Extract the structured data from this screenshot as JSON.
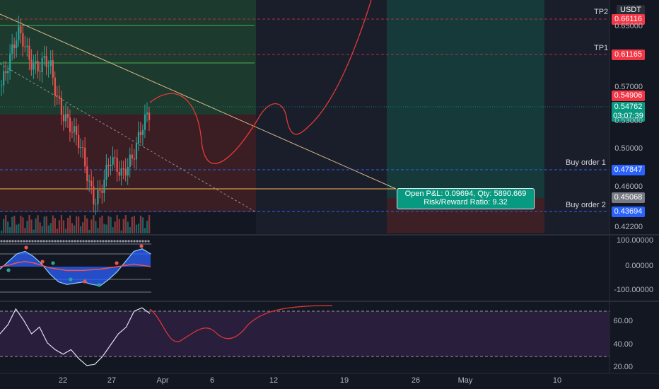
{
  "currency": "USDT",
  "levels": {
    "tp2": {
      "label": "TP2",
      "price": "0.66116"
    },
    "tp1": {
      "label": "TP1",
      "price": "0.61165"
    },
    "entry_upper": {
      "price": "0.54906"
    },
    "current": {
      "price": "0.54762",
      "countdown": "03:07:39"
    },
    "buy1": {
      "label": "Buy order 1",
      "price": "0.47847"
    },
    "mid": {
      "price": "0.45068"
    },
    "buy2": {
      "label": "Buy order 2",
      "price": "0.43694"
    }
  },
  "position_info": {
    "line1": "Open P&L: 0.09694, Qty: 5890.669",
    "line2": "Risk/Reward Ratio: 9.32"
  },
  "colors": {
    "background": "#131722",
    "up": "#26a69a",
    "down": "#ef5350",
    "projection": "#e53935",
    "tp_badge": "#f23645",
    "buy_badge": "#2962ff",
    "current_badge": "#089981"
  },
  "chart_data": [
    {
      "type": "line",
      "name": "price",
      "y_axis_ticks": [
        "0.65000",
        "0.57000",
        "0.53000",
        "0.50000",
        "0.46000",
        "0.42200"
      ],
      "x_axis_ticks": [
        "22",
        "27",
        "Apr",
        "6",
        "12",
        "19",
        "26",
        "May",
        "10"
      ],
      "ylim": [
        0.415,
        0.675
      ],
      "candles_approx_close": [
        0.58,
        0.6,
        0.62,
        0.64,
        0.63,
        0.61,
        0.6,
        0.6,
        0.61,
        0.6,
        0.57,
        0.55,
        0.54,
        0.53,
        0.52,
        0.5,
        0.47,
        0.45,
        0.46,
        0.48,
        0.5,
        0.49,
        0.48,
        0.49,
        0.5,
        0.52,
        0.54,
        0.548
      ]
    },
    {
      "type": "line",
      "name": "oscillator",
      "y_axis_ticks": [
        "100.00000",
        "0.00000",
        "-100.00000"
      ],
      "ylim": [
        -120,
        120
      ]
    },
    {
      "type": "line",
      "name": "rsi",
      "y_axis_ticks": [
        "60.00",
        "40.00",
        "20.00"
      ],
      "ylim": [
        15,
        85
      ],
      "values": [
        50,
        58,
        72,
        62,
        50,
        56,
        42,
        36,
        32,
        36,
        28,
        22,
        23,
        30,
        40,
        50,
        56,
        70,
        73,
        68
      ]
    }
  ]
}
